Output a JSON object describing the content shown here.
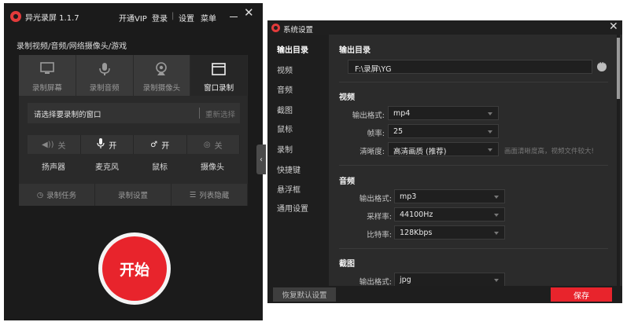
{
  "recorder": {
    "app_title": "异光录屏 1.1.7",
    "top_links": {
      "vip": "开通VIP",
      "login": "登录",
      "separator": "|",
      "settings": "设置",
      "menu": "菜单"
    },
    "subtitle": "录制视频/音频/网络摄像头/游戏",
    "mode_tabs": [
      {
        "label": "录制屏幕",
        "icon": "monitor-icon"
      },
      {
        "label": "录制音频",
        "icon": "microphone-icon"
      },
      {
        "label": "录制摄像头",
        "icon": "webcam-icon"
      },
      {
        "label": "窗口录制",
        "icon": "window-icon",
        "active": true
      }
    ],
    "window_select": {
      "text": "请选择要录制的窗口",
      "reselect": "重新选择"
    },
    "toggles": [
      {
        "state": "关",
        "label": "扬声器",
        "icon": "speaker-icon",
        "on": false
      },
      {
        "state": "开",
        "label": "麦克风",
        "icon": "microphone-icon",
        "on": true
      },
      {
        "state": "开",
        "label": "鼠标",
        "icon": "mouse-cursor-icon",
        "on": true
      },
      {
        "state": "关",
        "label": "摄像头",
        "icon": "webcam-icon",
        "on": false
      }
    ],
    "actions": [
      {
        "label": "录制任务",
        "icon": "alarm-clock-icon"
      },
      {
        "label": "录制设置",
        "icon": ""
      },
      {
        "label": "列表隐藏",
        "icon": "list-icon"
      }
    ],
    "start_label": "开始",
    "colors": {
      "accent": "#e8242c",
      "background": "#1b1b1b"
    }
  },
  "settings": {
    "title": "系统设置",
    "nav": [
      "输出目录",
      "视频",
      "音频",
      "截图",
      "鼠标",
      "录制",
      "快捷键",
      "悬浮框",
      "通用设置"
    ],
    "output_dir": {
      "heading": "输出目录",
      "path": "F:\\录屏\\YG"
    },
    "video": {
      "heading": "视频",
      "format_label": "输出格式:",
      "format": "mp4",
      "fps_label": "帧率:",
      "fps": "25",
      "quality_label": "清晰度:",
      "quality": "高清画质 (推荐)",
      "quality_hint": "画面清晰度高，视频文件较大!"
    },
    "audio": {
      "heading": "音频",
      "format_label": "输出格式:",
      "format": "mp3",
      "rate_label": "采样率:",
      "rate": "44100Hz",
      "bitrate_label": "比特率:",
      "bitrate": "128Kbps"
    },
    "screenshot": {
      "heading": "截图",
      "format_label": "输出格式:",
      "format": "jpg"
    },
    "reset_label": "恢复默认设置",
    "save_label": "保存"
  }
}
